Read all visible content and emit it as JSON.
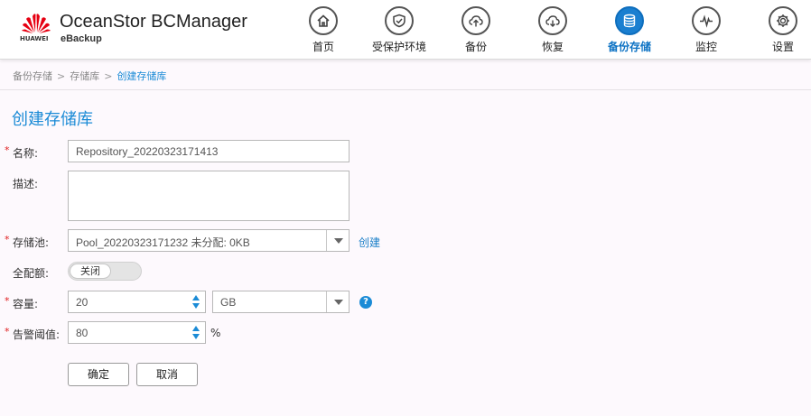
{
  "app": {
    "brand": "HUAWEI",
    "title": "OceanStor BCManager",
    "subtitle": "eBackup"
  },
  "nav": [
    {
      "label": "首页",
      "icon": "home-icon"
    },
    {
      "label": "受保护环境",
      "icon": "shield-icon"
    },
    {
      "label": "备份",
      "icon": "cloud-upload-icon"
    },
    {
      "label": "恢复",
      "icon": "cloud-download-icon"
    },
    {
      "label": "备份存储",
      "icon": "database-icon",
      "active": true
    },
    {
      "label": "监控",
      "icon": "pulse-icon"
    },
    {
      "label": "设置",
      "icon": "gear-icon"
    }
  ],
  "breadcrumb": {
    "items": [
      "备份存储",
      "存储库",
      "创建存储库"
    ],
    "separator": ">"
  },
  "page": {
    "title": "创建存储库"
  },
  "form": {
    "required_mark": "*",
    "name": {
      "label": "名称:",
      "value": "Repository_20220323171413"
    },
    "description": {
      "label": "描述:",
      "value": ""
    },
    "pool": {
      "label": "存储池:",
      "value": "Pool_20220323171232 未分配: 0KB",
      "create_link": "创建"
    },
    "full_quota": {
      "label": "全配额:",
      "toggle_label": "关闭",
      "state": "off"
    },
    "capacity": {
      "label": "容量:",
      "value": "20",
      "unit": "GB",
      "help": "?"
    },
    "alarm_threshold": {
      "label": "告警阈值:",
      "value": "80",
      "unit": "%"
    },
    "ok_button": "确定",
    "cancel_button": "取消"
  },
  "colors": {
    "accent": "#1b8bd6",
    "active_nav": "#1a7fd0",
    "required": "#e02020",
    "brand_red": "#e60012",
    "background": "#fdf9fd"
  }
}
